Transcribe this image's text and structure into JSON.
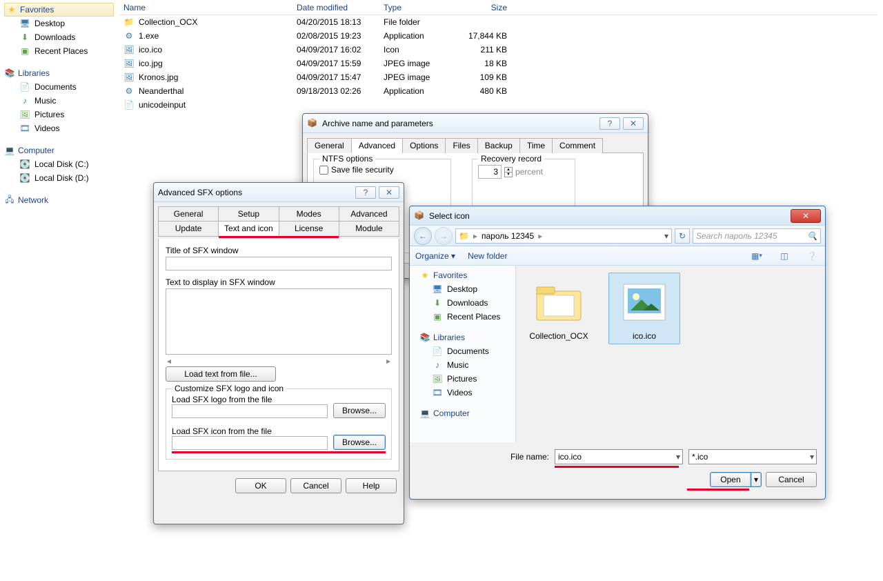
{
  "explorer": {
    "nav": {
      "favorites": {
        "title": "Favorites",
        "items": [
          "Desktop",
          "Downloads",
          "Recent Places"
        ]
      },
      "libraries": {
        "title": "Libraries",
        "items": [
          "Documents",
          "Music",
          "Pictures",
          "Videos"
        ]
      },
      "computer": {
        "title": "Computer",
        "items": [
          "Local Disk (C:)",
          "Local Disk (D:)"
        ]
      },
      "network": {
        "title": "Network"
      }
    },
    "columns": {
      "name": "Name",
      "date": "Date modified",
      "type": "Type",
      "size": "Size"
    },
    "files": [
      {
        "name": "Collection_OCX",
        "date": "04/20/2015 18:13",
        "type": "File folder",
        "size": ""
      },
      {
        "name": "1.exe",
        "date": "02/08/2015 19:23",
        "type": "Application",
        "size": "17,844 KB"
      },
      {
        "name": "ico.ico",
        "date": "04/09/2017 16:02",
        "type": "Icon",
        "size": "211 KB"
      },
      {
        "name": "ico.jpg",
        "date": "04/09/2017 15:59",
        "type": "JPEG image",
        "size": "18 KB"
      },
      {
        "name": "Kronos.jpg",
        "date": "04/09/2017 15:47",
        "type": "JPEG image",
        "size": "109 KB"
      },
      {
        "name": "Neanderthal",
        "date": "09/18/2013 02:26",
        "type": "Application",
        "size": "480 KB"
      },
      {
        "name": "unicodeinput",
        "date": "",
        "type": "",
        "size": ""
      }
    ]
  },
  "archive": {
    "title": "Archive name and parameters",
    "tabs": [
      "General",
      "Advanced",
      "Options",
      "Files",
      "Backup",
      "Time",
      "Comment"
    ],
    "active_tab": "Advanced",
    "ntfs_legend": "NTFS options",
    "save_sec": "Save file security",
    "recovery_legend": "Recovery record",
    "recovery_value": "3",
    "recovery_unit": "percent"
  },
  "sfx": {
    "title": "Advanced SFX options",
    "tabs_row1": [
      "General",
      "Setup",
      "Modes",
      "Advanced"
    ],
    "tabs_row2": [
      "Update",
      "Text and icon",
      "License",
      "Module"
    ],
    "active_tab": "Text and icon",
    "lbl_title": "Title of SFX window",
    "lbl_text": "Text to display in SFX window",
    "btn_loadtext": "Load text from file...",
    "legend_customize": "Customize SFX logo and icon",
    "lbl_logo": "Load SFX logo from the file",
    "lbl_icon": "Load SFX icon from the file",
    "btn_browse": "Browse...",
    "btn_ok": "OK",
    "btn_cancel": "Cancel",
    "btn_help": "Help"
  },
  "open": {
    "title": "Select icon",
    "breadcrumb": "пароль 12345",
    "search_placeholder": "Search пароль 12345",
    "toolbar": {
      "organize": "Organize",
      "newfolder": "New folder"
    },
    "nav": {
      "favorites": {
        "title": "Favorites",
        "items": [
          "Desktop",
          "Downloads",
          "Recent Places"
        ]
      },
      "libraries": {
        "title": "Libraries",
        "items": [
          "Documents",
          "Music",
          "Pictures",
          "Videos"
        ]
      },
      "computer": {
        "title": "Computer"
      }
    },
    "thumbs": [
      {
        "label": "Collection_OCX",
        "kind": "folder",
        "selected": false
      },
      {
        "label": "ico.ico",
        "kind": "icon",
        "selected": true
      }
    ],
    "filename_label": "File name:",
    "filename_value": "ico.ico",
    "filter_value": "*.ico",
    "btn_open": "Open",
    "btn_cancel": "Cancel"
  }
}
